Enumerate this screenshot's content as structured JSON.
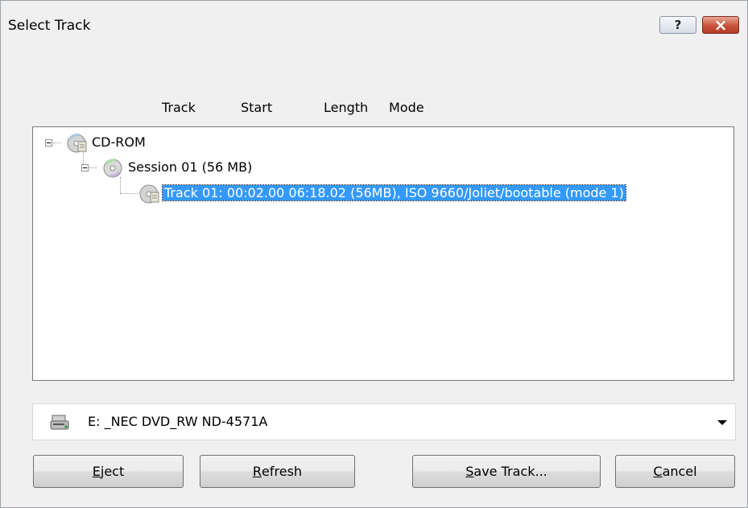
{
  "window": {
    "title": "Select Track",
    "help_label": "?",
    "close_label": "×"
  },
  "headers": {
    "track": "Track",
    "start": "Start",
    "length": "Length",
    "mode": "Mode"
  },
  "tree": {
    "root_label": "CD-ROM",
    "session_label": "Session 01 (56 MB)",
    "track_label": "Track 01: 00:02.00 06:18.02 (56MB), ISO 9660/Joliet/bootable (mode 1)"
  },
  "drive": {
    "selected": "E: _NEC DVD_RW ND-4571A",
    "icon": "drive-icon"
  },
  "buttons": {
    "eject": {
      "mnemonic": "E",
      "rest": "ject"
    },
    "refresh": {
      "mnemonic": "R",
      "rest": "efresh"
    },
    "save_track": {
      "mnemonic": "S",
      "rest": "ave Track..."
    },
    "cancel": {
      "mnemonic": "C",
      "rest": "ancel"
    }
  },
  "colors": {
    "selection": "#3399ff",
    "close_button": "#c8523a"
  }
}
